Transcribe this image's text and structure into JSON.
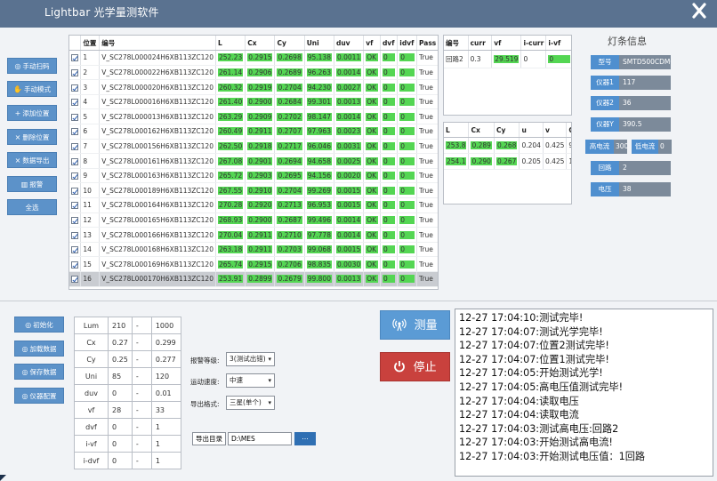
{
  "window": {
    "title": "Lightbar 光学量测软件"
  },
  "sidebar": [
    {
      "icon": "scan-icon",
      "glyph": "◎",
      "label": "手动扫码"
    },
    {
      "icon": "manual-icon",
      "glyph": "✋",
      "label": "手动模式"
    },
    {
      "icon": "plus-icon",
      "glyph": "+",
      "label": "添加位置"
    },
    {
      "icon": "delete-icon",
      "glyph": "×",
      "label": "删除位置"
    },
    {
      "icon": "export-icon",
      "glyph": "×",
      "label": "数据导出"
    },
    {
      "icon": "alarm-icon",
      "glyph": "▥",
      "label": "报警"
    },
    {
      "icon": "",
      "glyph": "",
      "label": "全选"
    }
  ],
  "main_table": {
    "columns": [
      "",
      "位置",
      "编号",
      "L",
      "Cx",
      "Cy",
      "Uni",
      "duv",
      "vf",
      "dvf",
      "idvf",
      "Pass"
    ],
    "rows": [
      {
        "pos": "1",
        "id": "V_SC278L000024H6XB113ZC120",
        "L": "252.23",
        "Cx": "0.2915",
        "Cy": "0.2698",
        "Uni": "95.138",
        "duv": "0.0011",
        "vf": "OK",
        "dvf": "0",
        "idvf": "0",
        "pass": "True"
      },
      {
        "pos": "2",
        "id": "V_SC278L000022H6XB113ZC120",
        "L": "261.14",
        "Cx": "0.2906",
        "Cy": "0.2689",
        "Uni": "96.263",
        "duv": "0.0014",
        "vf": "OK",
        "dvf": "0",
        "idvf": "0",
        "pass": "True"
      },
      {
        "pos": "3",
        "id": "V_SC278L000020H6XB113ZC120",
        "L": "260.32",
        "Cx": "0.2919",
        "Cy": "0.2704",
        "Uni": "94.230",
        "duv": "0.0027",
        "vf": "OK",
        "dvf": "0",
        "idvf": "0",
        "pass": "True"
      },
      {
        "pos": "4",
        "id": "V_SC278L000016H6XB113ZC120",
        "L": "261.40",
        "Cx": "0.2900",
        "Cy": "0.2684",
        "Uni": "99.301",
        "duv": "0.0013",
        "vf": "OK",
        "dvf": "0",
        "idvf": "0",
        "pass": "True"
      },
      {
        "pos": "5",
        "id": "V_SC278L000013H6XB113ZC120",
        "L": "263.29",
        "Cx": "0.2909",
        "Cy": "0.2702",
        "Uni": "98.147",
        "duv": "0.0014",
        "vf": "OK",
        "dvf": "0",
        "idvf": "0",
        "pass": "True"
      },
      {
        "pos": "6",
        "id": "V_SC278L000162H6XB113ZC120",
        "L": "260.49",
        "Cx": "0.2911",
        "Cy": "0.2707",
        "Uni": "97.963",
        "duv": "0.0023",
        "vf": "OK",
        "dvf": "0",
        "idvf": "0",
        "pass": "True"
      },
      {
        "pos": "7",
        "id": "V_SC278L000156H6XB113ZC120",
        "L": "262.50",
        "Cx": "0.2918",
        "Cy": "0.2717",
        "Uni": "96.046",
        "duv": "0.0031",
        "vf": "OK",
        "dvf": "0",
        "idvf": "0",
        "pass": "True"
      },
      {
        "pos": "8",
        "id": "V_SC278L000161H6XB113ZC120",
        "L": "267.08",
        "Cx": "0.2901",
        "Cy": "0.2694",
        "Uni": "94.658",
        "duv": "0.0025",
        "vf": "OK",
        "dvf": "0",
        "idvf": "0",
        "pass": "True"
      },
      {
        "pos": "9",
        "id": "V_SC278L000163H6XB113ZC120",
        "L": "265.72",
        "Cx": "0.2903",
        "Cy": "0.2695",
        "Uni": "94.156",
        "duv": "0.0020",
        "vf": "OK",
        "dvf": "0",
        "idvf": "0",
        "pass": "True"
      },
      {
        "pos": "10",
        "id": "V_SC278L000189H6XB113ZC120",
        "L": "267.55",
        "Cx": "0.2910",
        "Cy": "0.2704",
        "Uni": "99.269",
        "duv": "0.0015",
        "vf": "OK",
        "dvf": "0",
        "idvf": "0",
        "pass": "True"
      },
      {
        "pos": "11",
        "id": "V_SC278L000164H6XB113ZC120",
        "L": "270.28",
        "Cx": "0.2920",
        "Cy": "0.2713",
        "Uni": "96.953",
        "duv": "0.0015",
        "vf": "OK",
        "dvf": "0",
        "idvf": "0",
        "pass": "True"
      },
      {
        "pos": "12",
        "id": "V_SC278L000165H6XB113ZC120",
        "L": "268.93",
        "Cx": "0.2900",
        "Cy": "0.2687",
        "Uni": "99.496",
        "duv": "0.0014",
        "vf": "OK",
        "dvf": "0",
        "idvf": "0",
        "pass": "True"
      },
      {
        "pos": "13",
        "id": "V_SC278L000166H6XB113ZC120",
        "L": "270.04",
        "Cx": "0.2911",
        "Cy": "0.2710",
        "Uni": "97.778",
        "duv": "0.0014",
        "vf": "OK",
        "dvf": "0",
        "idvf": "0",
        "pass": "True"
      },
      {
        "pos": "14",
        "id": "V_SC278L000168H6XB113ZC120",
        "L": "263.18",
        "Cx": "0.2911",
        "Cy": "0.2703",
        "Uni": "99.068",
        "duv": "0.0015",
        "vf": "OK",
        "dvf": "0",
        "idvf": "0",
        "pass": "True"
      },
      {
        "pos": "15",
        "id": "V_SC278L000169H6XB113ZC120",
        "L": "265.74",
        "Cx": "0.2915",
        "Cy": "0.2706",
        "Uni": "98.835",
        "duv": "0.0030",
        "vf": "OK",
        "dvf": "0",
        "idvf": "0",
        "pass": "True"
      },
      {
        "pos": "16",
        "id": "V_SC278L000170H6XB113ZC120",
        "L": "253.91",
        "Cx": "0.2899",
        "Cy": "0.2679",
        "Uni": "99.800",
        "duv": "0.0013",
        "vf": "OK",
        "dvf": "0",
        "idvf": "0",
        "pass": "True",
        "selected": true
      }
    ]
  },
  "circuit_table": {
    "columns": [
      "编号",
      "curr",
      "vf",
      "i-curr",
      "i-vf"
    ],
    "rows": [
      [
        "回路2",
        "0.3",
        "29.519",
        "0",
        "0"
      ]
    ]
  },
  "optic_table": {
    "columns": [
      "L",
      "Cx",
      "Cy",
      "u",
      "v",
      "CCT"
    ],
    "rows": [
      [
        "253.8",
        "0.289",
        "0.268",
        "0.204",
        "0.425",
        "9994"
      ],
      [
        "254.1",
        "0.290",
        "0.267",
        "0.205",
        "0.425",
        "10692"
      ]
    ]
  },
  "info_panel": {
    "title": "灯条信息",
    "items": [
      {
        "label": "型号",
        "value": "SMTD500CDM00"
      },
      {
        "label": "仪器1",
        "value": "117"
      },
      {
        "label": "仪器2",
        "value": "36"
      },
      {
        "label": "仪器Y",
        "value": "390.5"
      },
      {
        "label": "高电流",
        "value": "300"
      },
      {
        "label": "低电流",
        "value": "0"
      },
      {
        "label": "回路",
        "value": "2"
      },
      {
        "label": "电压",
        "value": "38"
      }
    ]
  },
  "bottom_buttons": [
    {
      "icon": "init-icon",
      "label": "初始化"
    },
    {
      "icon": "load-icon",
      "label": "加载数据"
    },
    {
      "icon": "save-icon",
      "label": "保存数据"
    },
    {
      "icon": "config-icon",
      "label": "仪器配置"
    }
  ],
  "limits": [
    [
      "Lum",
      "210",
      "-",
      "1000"
    ],
    [
      "Cx",
      "0.27",
      "-",
      "0.299"
    ],
    [
      "Cy",
      "0.25",
      "-",
      "0.277"
    ],
    [
      "Uni",
      "85",
      "-",
      "120"
    ],
    [
      "duv",
      "0",
      "-",
      "0.01"
    ],
    [
      "vf",
      "28",
      "-",
      "33"
    ],
    [
      "dvf",
      "0",
      "-",
      "1"
    ],
    [
      "i-vf",
      "0",
      "-",
      "1"
    ],
    [
      "i-dvf",
      "0",
      "-",
      "1"
    ]
  ],
  "settings": {
    "alarm_level_label": "报警等级:",
    "alarm_level_value": "3(测试出错)",
    "speed_label": "运动速度:",
    "speed_value": "中速",
    "export_format_label": "导出格式:",
    "export_format_value": "三星(单个)",
    "export_dir_label": "导出目录",
    "export_dir_value": "D:\\MES",
    "browse_label": "..."
  },
  "actions": {
    "measure": "测量",
    "stop": "停止"
  },
  "log": [
    "12-27 17:04:10:测试完毕!",
    "12-27 17:04:07:测试光学完毕!",
    "12-27 17:04:07:位置2测试完毕!",
    "12-27 17:04:07:位置1测试完毕!",
    "12-27 17:04:05:开始测试光学!",
    "12-27 17:04:05:高电压值测试完毕!",
    "12-27 17:04:04:读取电压",
    "12-27 17:04:04:读取电流",
    "12-27 17:04:03:测试高电压:回路2",
    "12-27 17:04:03:开始测试高电流!",
    "12-27 17:04:03:开始测试电压值：1回路"
  ]
}
